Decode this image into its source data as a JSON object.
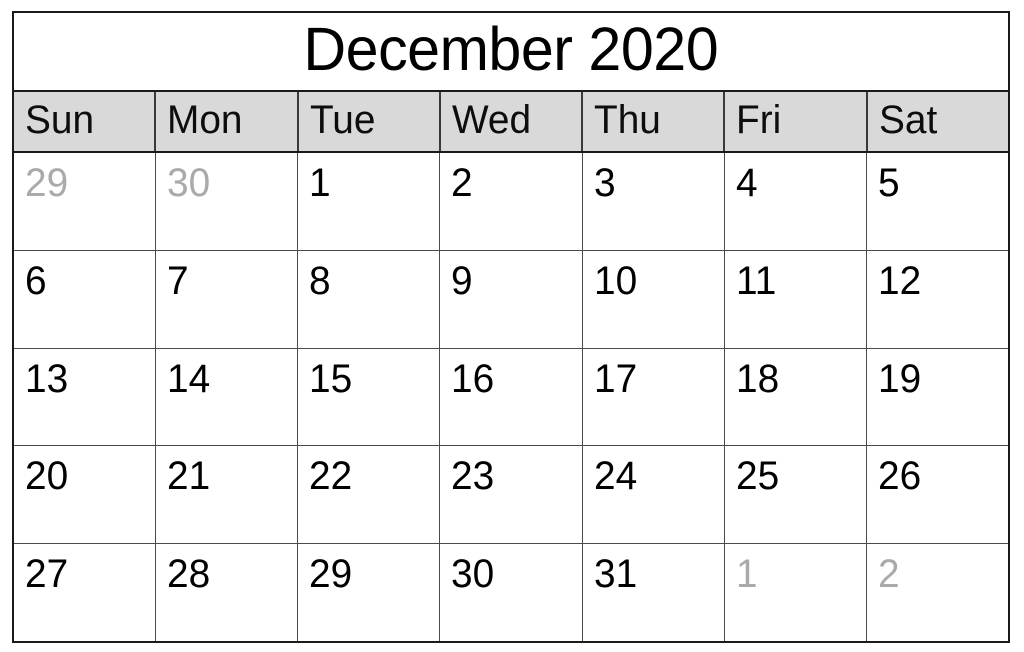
{
  "calendar": {
    "title": "December 2020",
    "month": "December",
    "year": "2020",
    "colors": {
      "header_background": "#d9d9d9",
      "border": "#1a1a1a",
      "grid_line": "#4a4a4a",
      "in_month_text": "#000000",
      "out_of_month_text": "#aaaaaa",
      "page_background": "#ffffff"
    },
    "weekdays": [
      {
        "short": "Sun"
      },
      {
        "short": "Mon"
      },
      {
        "short": "Tue"
      },
      {
        "short": "Wed"
      },
      {
        "short": "Thu"
      },
      {
        "short": "Fri"
      },
      {
        "short": "Sat"
      }
    ],
    "weeks": [
      {
        "days": [
          {
            "label": "29",
            "in_month": false
          },
          {
            "label": "30",
            "in_month": false
          },
          {
            "label": "1",
            "in_month": true
          },
          {
            "label": "2",
            "in_month": true
          },
          {
            "label": "3",
            "in_month": true
          },
          {
            "label": "4",
            "in_month": true
          },
          {
            "label": "5",
            "in_month": true
          }
        ]
      },
      {
        "days": [
          {
            "label": "6",
            "in_month": true
          },
          {
            "label": "7",
            "in_month": true
          },
          {
            "label": "8",
            "in_month": true
          },
          {
            "label": "9",
            "in_month": true
          },
          {
            "label": "10",
            "in_month": true
          },
          {
            "label": "11",
            "in_month": true
          },
          {
            "label": "12",
            "in_month": true
          }
        ]
      },
      {
        "days": [
          {
            "label": "13",
            "in_month": true
          },
          {
            "label": "14",
            "in_month": true
          },
          {
            "label": "15",
            "in_month": true
          },
          {
            "label": "16",
            "in_month": true
          },
          {
            "label": "17",
            "in_month": true
          },
          {
            "label": "18",
            "in_month": true
          },
          {
            "label": "19",
            "in_month": true
          }
        ]
      },
      {
        "days": [
          {
            "label": "20",
            "in_month": true
          },
          {
            "label": "21",
            "in_month": true
          },
          {
            "label": "22",
            "in_month": true
          },
          {
            "label": "23",
            "in_month": true
          },
          {
            "label": "24",
            "in_month": true
          },
          {
            "label": "25",
            "in_month": true
          },
          {
            "label": "26",
            "in_month": true
          }
        ]
      },
      {
        "days": [
          {
            "label": "27",
            "in_month": true
          },
          {
            "label": "28",
            "in_month": true
          },
          {
            "label": "29",
            "in_month": true
          },
          {
            "label": "30",
            "in_month": true
          },
          {
            "label": "31",
            "in_month": true
          },
          {
            "label": "1",
            "in_month": false
          },
          {
            "label": "2",
            "in_month": false
          }
        ]
      }
    ]
  }
}
